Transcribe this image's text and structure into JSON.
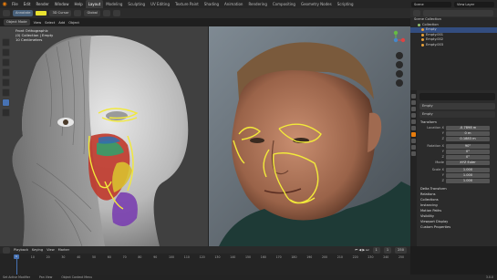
{
  "menu": {
    "items": [
      "File",
      "Edit",
      "Render",
      "Window",
      "Help"
    ],
    "workspaces": [
      "Layout",
      "Modeling",
      "Sculpting",
      "UV Editing",
      "Texture Paint",
      "Shading",
      "Animation",
      "Rendering",
      "Compositing",
      "Geometry Nodes",
      "Scripting"
    ],
    "active_workspace": "Layout",
    "scene": "Scene",
    "view_layer": "View Layer"
  },
  "toolheader": {
    "mode": "Annotate",
    "placement": "3D Cursor",
    "orientation": "Global"
  },
  "viewport_header": {
    "items": [
      "Object Mode",
      "View",
      "Select",
      "Add",
      "Object"
    ]
  },
  "overlay": {
    "line1": "Front Orthographic",
    "line2": "(0) Collection | Empty",
    "line3": "10 Centimeters"
  },
  "outliner": {
    "header": "Scene Collection",
    "rows": [
      {
        "label": "Collection",
        "type": "collection"
      },
      {
        "label": "Empty",
        "type": "object"
      },
      {
        "label": "Empty.001",
        "type": "object"
      },
      {
        "label": "Empty.002",
        "type": "object"
      },
      {
        "label": "Empty.003",
        "type": "object"
      }
    ]
  },
  "properties": {
    "object_name": "Empty",
    "data_name": "Empty",
    "transform_header": "Transform",
    "rows": [
      {
        "label": "Location X",
        "value": "-0.7898 m"
      },
      {
        "label": "Y",
        "value": "0 m"
      },
      {
        "label": "Z",
        "value": "0.1883 m"
      },
      {
        "label": "Rotation X",
        "value": "90°"
      },
      {
        "label": "Y",
        "value": "0°"
      },
      {
        "label": "Z",
        "value": "0°"
      },
      {
        "label": "Mode",
        "value": "XYZ Euler"
      },
      {
        "label": "Scale X",
        "value": "1.000"
      },
      {
        "label": "Y",
        "value": "1.000"
      },
      {
        "label": "Z",
        "value": "1.000"
      }
    ],
    "sections": [
      "Delta Transform",
      "Relations",
      "Collections",
      "Instancing",
      "Motion Paths",
      "Visibility",
      "Viewport Display",
      "Custom Properties"
    ]
  },
  "timeline": {
    "items": [
      "Playback",
      "Keying",
      "View",
      "Marker"
    ],
    "current_frame": "1",
    "start": "1",
    "end": "250",
    "ticks": [
      "0",
      "10",
      "20",
      "30",
      "40",
      "50",
      "60",
      "70",
      "80",
      "90",
      "100",
      "110",
      "120",
      "130",
      "140",
      "150",
      "160",
      "170",
      "180",
      "190",
      "200",
      "210",
      "220",
      "230",
      "240",
      "250"
    ]
  },
  "status": {
    "left": "Set Active Modifier",
    "middle": "Pan View",
    "right": "Object Context Menu",
    "version": "3.0.0"
  },
  "colors": {
    "accent": "#4772b3",
    "annotation": "#e8e230",
    "orange": "#e87d0d"
  }
}
